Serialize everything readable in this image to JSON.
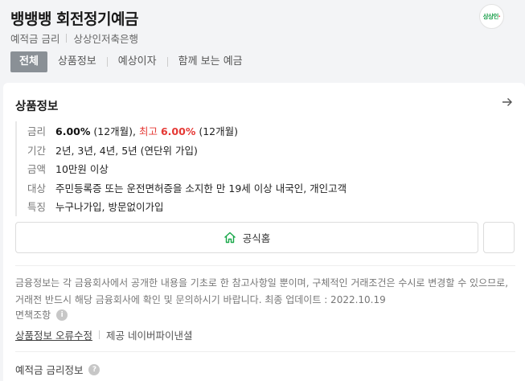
{
  "header": {
    "title": "뱅뱅뱅 회전정기예금",
    "category": "예적금 금리",
    "bank": "상상인저축은행",
    "logo_text": "상상인",
    "tabs": [
      {
        "label": "전체",
        "active": true
      },
      {
        "label": "상품정보",
        "active": false
      },
      {
        "label": "예상이자",
        "active": false
      },
      {
        "label": "함께 보는 예금",
        "active": false
      }
    ]
  },
  "product_info": {
    "section_title": "상품정보",
    "rows": [
      {
        "label": "금리",
        "base_rate": "6.00%",
        "base_term": "(12개월),",
        "max_label": "최고",
        "max_rate": "6.00%",
        "max_term": "(12개월)"
      },
      {
        "label": "기간",
        "value": "2년, 3년, 4년, 5년 (연단위 가입)"
      },
      {
        "label": "금액",
        "value": "10만원 이상"
      },
      {
        "label": "대상",
        "value": "주민등록증 또는 운전면허증을 소지한 만 19세 이상 내국인, 개인고객"
      },
      {
        "label": "특징",
        "value": "누구나가입, 방문없이가입"
      }
    ],
    "home_button": "공식홈"
  },
  "notice": {
    "text": "금융정보는 각 금융회사에서 공개한 내용을 기초로 한 참고사항일 뿐이며, 구체적인 거래조건은 수시로 변경할 수 있으므로, 거래전 반드시 해당 금융회사에 확인 및 문의하시기 바랍니다. 최종 업데이트 : 2022.10.19",
    "disclaimer": "면책조항"
  },
  "footer": {
    "report_link": "상품정보 오류수정",
    "provider": "제공 네이버파이낸셜"
  },
  "rate_info_title": "예적금 금리정보",
  "colors": {
    "accent_red": "#e53935",
    "home_green": "#19a84a",
    "logo_green": "#1a9e4a",
    "active_tab_bg": "#8a9096"
  }
}
